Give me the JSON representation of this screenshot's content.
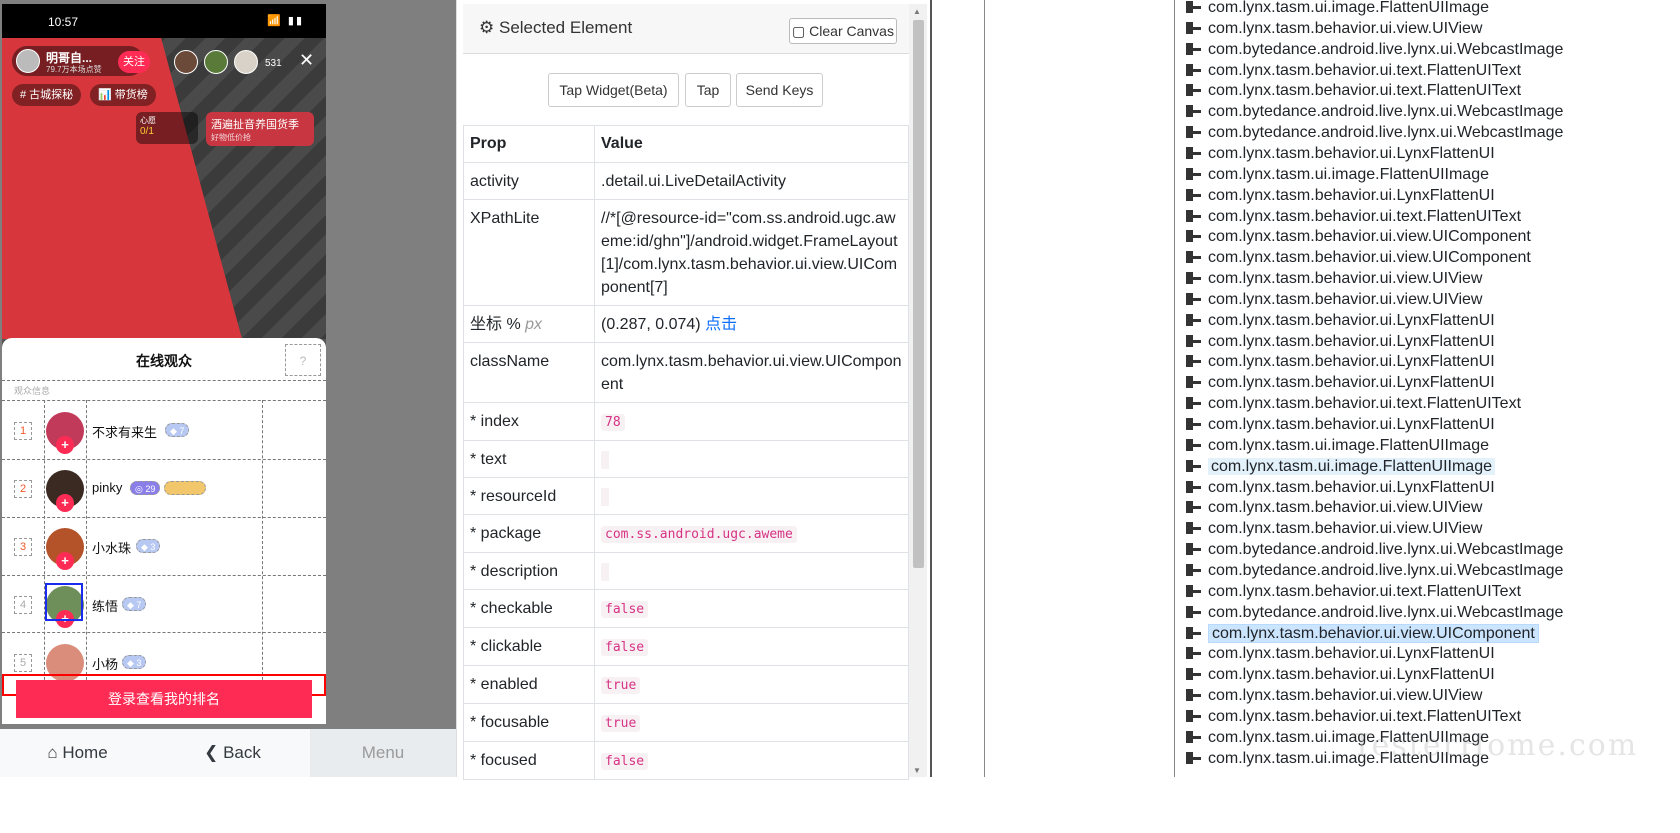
{
  "phone": {
    "status_time": "10:57",
    "status_icons": "📶 ▮▮",
    "host_name": "明哥自...",
    "host_likes": "79.7万本场点赞",
    "follow_label": "关注",
    "viewer_count": "531",
    "close": "✕",
    "tags": [
      "# 古城探秘",
      "📊 带货榜"
    ],
    "wish_label": "心愿",
    "wish_progress": "0/1",
    "promo_title": "酒遍扯音养国货季",
    "promo_sub": "好物低价抢",
    "sheet_title": "在线观众",
    "help": "?",
    "sheet_sub": "观众信息",
    "viewers": [
      {
        "rank": "1",
        "name": "不求有来生",
        "badge": "◆ 7"
      },
      {
        "rank": "2",
        "name": "pinky",
        "badge": "◎ 29"
      },
      {
        "rank": "3",
        "name": "小水珠",
        "badge": "◆ 3"
      },
      {
        "rank": "4",
        "name": "练悟",
        "badge": "◆ 7"
      },
      {
        "rank": "5",
        "name": "小杨",
        "badge": "◆ 3"
      }
    ],
    "login_button": "登录查看我的排名"
  },
  "nav": {
    "home": "⌂ Home",
    "back": "❮ Back",
    "menu": "Menu"
  },
  "panel": {
    "title": "Selected Element",
    "clear_canvas": "▢ Clear Canvas",
    "buttons": [
      "Tap Widget(Beta)",
      "Tap",
      "Send Keys"
    ],
    "col_prop": "Prop",
    "col_value": "Value",
    "activity_label": "activity",
    "activity_value": ".detail.ui.LiveDetailActivity",
    "xpath_label": "XPathLite",
    "xpath_value": "//*[@resource-id=\"com.ss.android.ugc.aweme:id/ghn\"]/android.widget.FrameLayout[1]/com.lynx.tasm.behavior.ui.view.UIComponent[7]",
    "coord_label": "坐标 %",
    "coord_unit": "px",
    "coord_value": "(0.287, 0.074)",
    "coord_link": "点击",
    "classname_label": "className",
    "classname_value": "com.lynx.tasm.behavior.ui.view.UIComponent",
    "attrs": [
      {
        "label": "* index",
        "value": "78"
      },
      {
        "label": "* text",
        "value": ""
      },
      {
        "label": "* resourceId",
        "value": ""
      },
      {
        "label": "* package",
        "value": "com.ss.android.ugc.aweme"
      },
      {
        "label": "* description",
        "value": ""
      },
      {
        "label": "* checkable",
        "value": "false"
      },
      {
        "label": "* clickable",
        "value": "false"
      },
      {
        "label": "* enabled",
        "value": "true"
      },
      {
        "label": "* focusable",
        "value": "true"
      },
      {
        "label": "* focused",
        "value": "false"
      }
    ]
  },
  "tree": [
    "com.lynx.tasm.ui.image.FlattenUIImage",
    "com.lynx.tasm.behavior.ui.view.UIView",
    "com.bytedance.android.live.lynx.ui.WebcastImage",
    "com.lynx.tasm.behavior.ui.text.FlattenUIText",
    "com.lynx.tasm.behavior.ui.text.FlattenUIText",
    "com.bytedance.android.live.lynx.ui.WebcastImage",
    "com.bytedance.android.live.lynx.ui.WebcastImage",
    "com.lynx.tasm.behavior.ui.LynxFlattenUI",
    "com.lynx.tasm.ui.image.FlattenUIImage",
    "com.lynx.tasm.behavior.ui.LynxFlattenUI",
    "com.lynx.tasm.behavior.ui.text.FlattenUIText",
    "com.lynx.tasm.behavior.ui.view.UIComponent",
    "com.lynx.tasm.behavior.ui.view.UIComponent",
    "com.lynx.tasm.behavior.ui.view.UIView",
    "com.lynx.tasm.behavior.ui.view.UIView",
    "com.lynx.tasm.behavior.ui.LynxFlattenUI",
    "com.lynx.tasm.behavior.ui.LynxFlattenUI",
    "com.lynx.tasm.behavior.ui.LynxFlattenUI",
    "com.lynx.tasm.behavior.ui.LynxFlattenUI",
    "com.lynx.tasm.behavior.ui.text.FlattenUIText",
    "com.lynx.tasm.behavior.ui.LynxFlattenUI",
    "com.lynx.tasm.ui.image.FlattenUIImage",
    "com.lynx.tasm.ui.image.FlattenUIImage",
    "com.lynx.tasm.behavior.ui.LynxFlattenUI",
    "com.lynx.tasm.behavior.ui.view.UIView",
    "com.lynx.tasm.behavior.ui.view.UIView",
    "com.bytedance.android.live.lynx.ui.WebcastImage",
    "com.bytedance.android.live.lynx.ui.WebcastImage",
    "com.lynx.tasm.behavior.ui.text.FlattenUIText",
    "com.bytedance.android.live.lynx.ui.WebcastImage",
    "com.lynx.tasm.behavior.ui.view.UIComponent",
    "com.lynx.tasm.behavior.ui.LynxFlattenUI",
    "com.lynx.tasm.behavior.ui.LynxFlattenUI",
    "com.lynx.tasm.behavior.ui.view.UIView",
    "com.lynx.tasm.behavior.ui.text.FlattenUIText",
    "com.lynx.tasm.ui.image.FlattenUIImage",
    "com.lynx.tasm.ui.image.FlattenUIImage"
  ],
  "tree_highlight_light": 22,
  "tree_highlight_selected": 30,
  "watermark": "TesterHome.com"
}
